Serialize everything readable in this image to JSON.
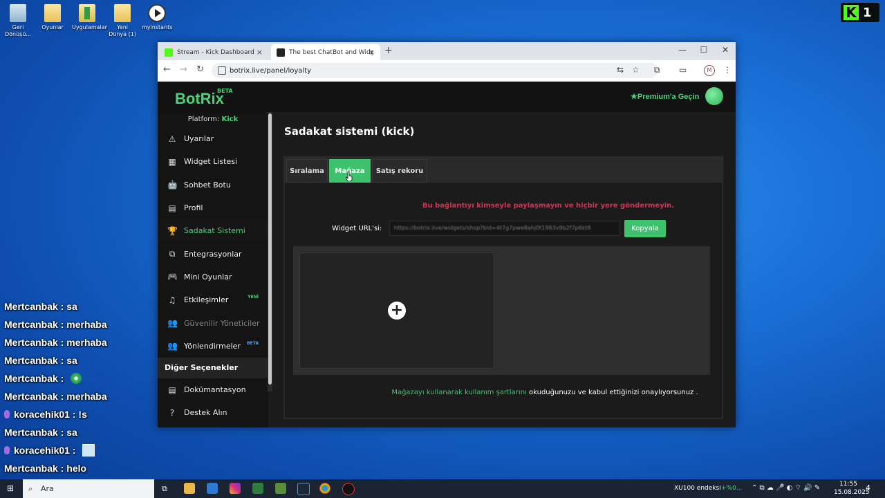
{
  "desktop": {
    "icons": [
      {
        "label": "Geri Dönüşü...",
        "icon": "recycle-bin-icon"
      },
      {
        "label": "Oyunlar",
        "icon": "folder-icon"
      },
      {
        "label": "Uygulamalar",
        "icon": "folder-icon"
      },
      {
        "label": "Yeni Dünya (1)",
        "icon": "folder-icon"
      },
      {
        "label": "myinstants",
        "icon": "play-icon"
      }
    ],
    "kick_badge": {
      "letter": "K",
      "count": "1"
    }
  },
  "chat": [
    {
      "user": "Mertcanbak",
      "sep": " : ",
      "msg": "sa",
      "badge": false
    },
    {
      "user": "Mertcanbak",
      "sep": " : ",
      "msg": "merhaba",
      "badge": false
    },
    {
      "user": "Mertcanbak",
      "sep": " : ",
      "msg": "merhaba",
      "badge": false
    },
    {
      "user": "Mertcanbak",
      "sep": " : ",
      "msg": "sa",
      "badge": false
    },
    {
      "user": "Mertcanbak",
      "sep": " : ",
      "msg": "",
      "badge": false,
      "emote": true
    },
    {
      "user": "Mertcanbak",
      "sep": " : ",
      "msg": "merhaba",
      "badge": false
    },
    {
      "user": "koracehik01",
      "sep": " : ",
      "msg": "!s",
      "badge": true
    },
    {
      "user": "Mertcanbak",
      "sep": " : ",
      "msg": "sa",
      "badge": false
    },
    {
      "user": "koracehik01",
      "sep": " : ",
      "msg": "",
      "badge": true,
      "image": true
    },
    {
      "user": "Mertcanbak",
      "sep": " : ",
      "msg": "helo",
      "badge": false
    }
  ],
  "browser": {
    "tabs": [
      {
        "title": "Stream - Kick Dashboard",
        "close": "×"
      },
      {
        "title": "The best ChatBot and Widgets",
        "close": "×"
      }
    ],
    "new_tab": "+",
    "window": {
      "minimize": "—",
      "maximize": "☐",
      "close": "✕"
    },
    "nav": {
      "back": "←",
      "forward": "→",
      "reload": "↻"
    },
    "url": "botrix.live/panel/loyalty",
    "profile_initial": "M"
  },
  "app": {
    "logo": "BotRix",
    "logo_badge": "BETA",
    "premium": "★Premium'a Geçin",
    "platform_label": "Platform:",
    "platform_value": "Kick",
    "sidebar": [
      {
        "label": "Uyarılar",
        "icon": "⚠"
      },
      {
        "label": "Widget Listesi",
        "icon": "▦"
      },
      {
        "label": "Sohbet Botu",
        "icon": "🤖"
      },
      {
        "label": "Profil",
        "icon": "▤"
      },
      {
        "label": "Sadakat Sistemi",
        "icon": "🏆"
      },
      {
        "label": "Entegrasyonlar",
        "icon": "⧉"
      },
      {
        "label": "Mini Oyunlar",
        "icon": "🎮"
      },
      {
        "label": "Etkileşimler",
        "icon": "♫",
        "badge": "YENİ"
      },
      {
        "label": "Güvenilir Yöneticiler",
        "icon": "👥"
      },
      {
        "label": "Yönlendirmeler",
        "icon": "👥",
        "badge": "BETA"
      }
    ],
    "section_other": "Diğer Seçenekler",
    "other_items": [
      {
        "label": "Dokümantasyon",
        "icon": "▤"
      },
      {
        "label": "Destek Alın",
        "icon": "?"
      }
    ],
    "page_title": "Sadakat sistemi (kick)",
    "tabs": [
      "Sıralama",
      "Mağaza",
      "Satış rekoru"
    ],
    "warning": "Bu bağlantıyı kimseyle paylaşmayın ve hiçbir yere göndermeyin.",
    "widget_url_label": "Widget URL'si:",
    "widget_url_value": "https://botrix.live/widgets/shop?bid=4t7g7pwe8ahj0t1983v9b2f7p6kt8",
    "copy_button": "Kopyala",
    "add_symbol": "+",
    "terms_link": "Mağazayı kullanarak kullanım şartlarını",
    "terms_rest": " okuduğunuzu ve kabul ettiğinizi onaylıyorsunuz ."
  },
  "taskbar": {
    "search_placeholder": "Ara",
    "ticker": "XU100 endeksi",
    "ticker_change": "+%0...",
    "time": "11:55",
    "date": "15.08.2025",
    "notifications": "4"
  },
  "colors": {
    "accent": "#3fc26d",
    "warning": "#d8304f",
    "kick": "#53fc18"
  }
}
